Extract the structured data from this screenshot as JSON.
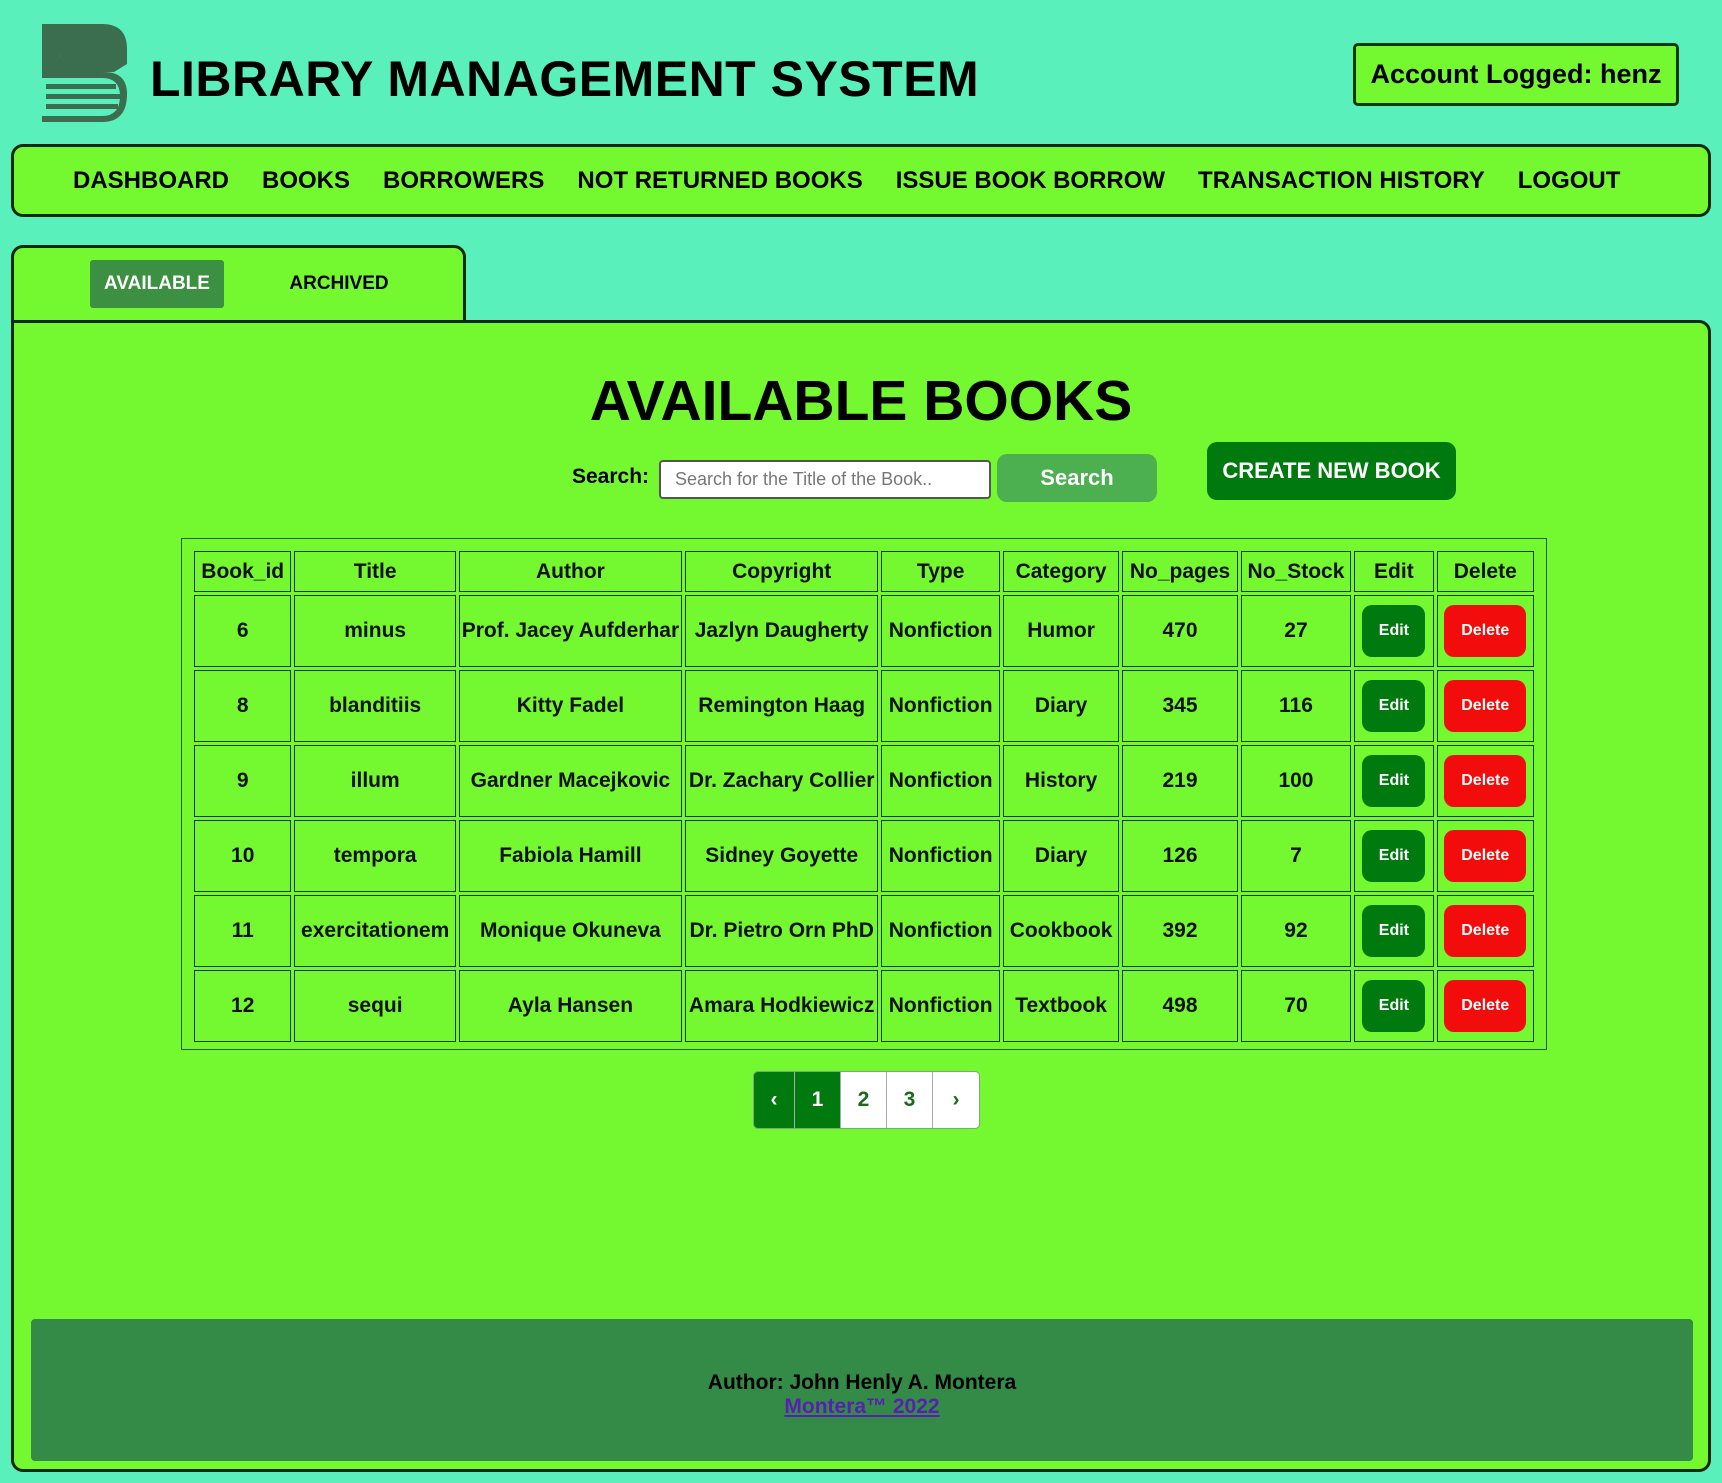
{
  "header": {
    "title": "LIBRARY MANAGEMENT SYSTEM",
    "account": "Account Logged: henz",
    "logo_color": "#3b6e4e"
  },
  "nav": {
    "items": [
      "DASHBOARD",
      "BOOKS",
      "BORROWERS",
      "NOT RETURNED BOOKS",
      "ISSUE BOOK BORROW",
      "TRANSACTION HISTORY",
      "LOGOUT"
    ]
  },
  "tabs": {
    "available": "AVAILABLE",
    "archived": "ARCHIVED"
  },
  "main": {
    "heading": "AVAILABLE BOOKS",
    "search_label": "Search:",
    "search_placeholder": "Search for the Title of the Book..",
    "search_button": "Search",
    "create_button": "CREATE NEW BOOK"
  },
  "table": {
    "headers": [
      "Book_id",
      "Title",
      "Author",
      "Copyright",
      "Type",
      "Category",
      "No_pages",
      "No_Stock",
      "Edit",
      "Delete"
    ],
    "edit_label": "Edit",
    "delete_label": "Delete",
    "rows": [
      [
        "6",
        "minus",
        "Prof. Jacey Aufderhar",
        "Jazlyn Daugherty",
        "Nonfiction",
        "Humor",
        "470",
        "27"
      ],
      [
        "8",
        "blanditiis",
        "Kitty Fadel",
        "Remington Haag",
        "Nonfiction",
        "Diary",
        "345",
        "116"
      ],
      [
        "9",
        "illum",
        "Gardner Macejkovic",
        "Dr. Zachary Collier",
        "Nonfiction",
        "History",
        "219",
        "100"
      ],
      [
        "10",
        "tempora",
        "Fabiola Hamill",
        "Sidney Goyette",
        "Nonfiction",
        "Diary",
        "126",
        "7"
      ],
      [
        "11",
        "exercitationem",
        "Monique Okuneva",
        "Dr. Pietro Orn PhD",
        "Nonfiction",
        "Cookbook",
        "392",
        "92"
      ],
      [
        "12",
        "sequi",
        "Ayla Hansen",
        "Amara Hodkiewicz",
        "Nonfiction",
        "Textbook",
        "498",
        "70"
      ]
    ]
  },
  "pagination": {
    "prev": "‹",
    "pages": [
      "1",
      "2",
      "3"
    ],
    "current": "1",
    "next": "›"
  },
  "footer": {
    "author": "Author: John Henly A. Montera",
    "link": "Montera™ 2022"
  },
  "colors": {
    "page_bg": "#5af0bb",
    "panel_bg": "#74f830",
    "dark_green": "#007a0e",
    "delete_red": "#f20c0c",
    "footer_bg": "#338b47"
  }
}
